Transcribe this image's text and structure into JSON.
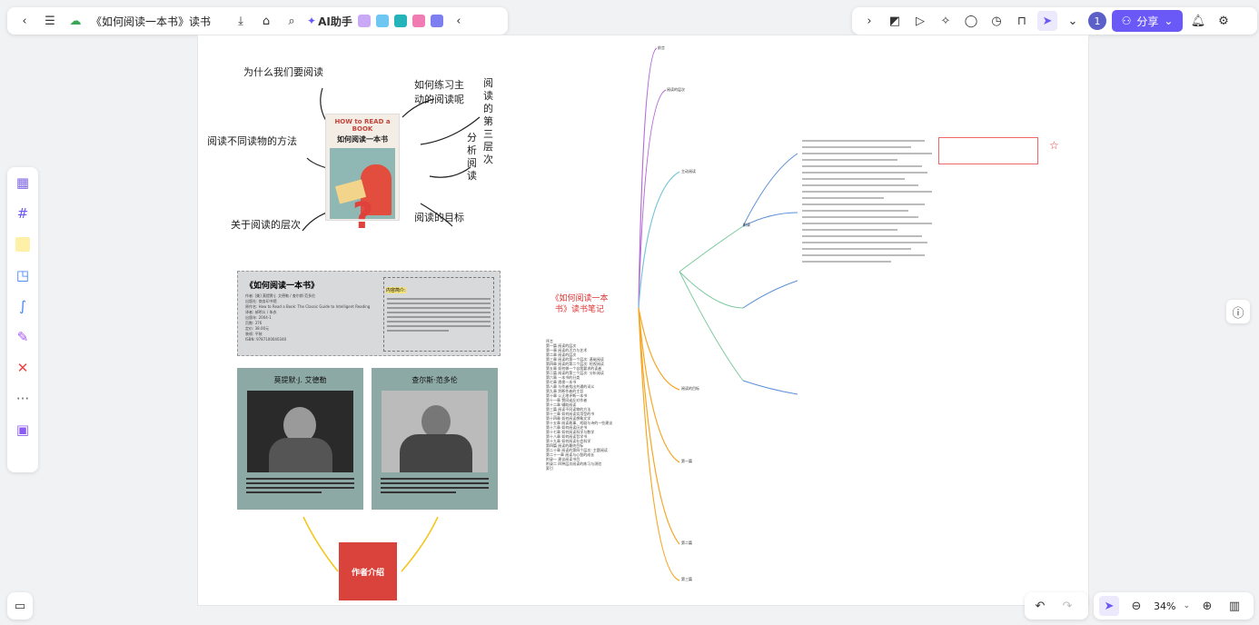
{
  "toolbar": {
    "doc_title": "《如何阅读一本书》读书...",
    "ai_label": "AI助手",
    "share_label": "分享",
    "avatar_label": "1"
  },
  "icons": [
    "back-icon",
    "menu-icon",
    "cloud-icon",
    "download-icon",
    "tag-icon",
    "search-icon"
  ],
  "book_cover": {
    "title_en": "HOW to READ a BOOK",
    "title_cn": "如何阅读一本书"
  },
  "sketch_labels": [
    "为什么我们要阅读",
    "如何练习主动的阅读呢",
    "阅读的第三层次",
    "阅读不同读物的方法",
    "分析阅读",
    "关于阅读的层次",
    "阅读的目标"
  ],
  "info_card": {
    "title": "《如何阅读一本书》",
    "lines": [
      "作者: [美] 莫提默·J. 艾德勒 / 查尔斯·范多伦",
      "出版社: 商务印书馆",
      "原作名: How to Read a Book: The Classic Guide to Intelligent Reading",
      "译者: 郝明义 / 朱衣",
      "出版年: 2004-1",
      "页数: 376",
      "定价: 38.00元",
      "装帧: 平装",
      "ISBN: 9787100040340"
    ],
    "intro_heading": "内容简介:"
  },
  "authors": [
    {
      "name": "莫提默·J. 艾德勒"
    },
    {
      "name": "查尔斯·范多伦"
    }
  ],
  "author_label": "作者介绍",
  "mindmap": {
    "center": "《如何阅读一本书》读书笔记",
    "branches": [
      "前言",
      "阅读的层次",
      "主动阅读",
      "阅读的目标",
      "第一篇",
      "第二篇",
      "第三篇",
      "附录"
    ]
  },
  "toc": [
    "序言",
    "第一篇 阅读的层次",
    "第一章 阅读的活力与艺术",
    "第二章 阅读的层次",
    "第三章 阅读的第一个层次: 基础阅读",
    "第四章 阅读的第二个层次: 检视阅读",
    "第五章 如何做一个自我要求的读者",
    "第二篇 阅读的第三个层次: 分析阅读",
    "第六章 一本书的分类",
    "第七章 透视一本书",
    "第八章 与作者找出共通的词义",
    "第九章 判断作者的主旨",
    "第十章 公正地评断一本书",
    "第十一章 赞同或反对作者",
    "第十二章 辅助阅读",
    "第三篇 阅读不同读物的方法",
    "第十三章 如何阅读实用型的书",
    "第十四章 如何阅读想象文学",
    "第十五章 阅读故事、戏剧与诗的一些建议",
    "第十六章 如何阅读历史书",
    "第十七章 如何阅读科学与数学",
    "第十八章 如何阅读哲学书",
    "第十九章 如何阅读社会科学",
    "第四篇 阅读的最终目标",
    "第二十章 阅读的第四个层次: 主题阅读",
    "第二十一章 阅读与心智的成长",
    "附录一 建议阅读书目",
    "附录二 四种层次阅读的练习与测验",
    "索引"
  ],
  "zoom": "34%",
  "colors": {
    "accent": "#6b59f7",
    "card_bg": "#d8d9da",
    "author_bg": "#8ca9a5",
    "red": "#d9433b",
    "center_red": "#d33"
  }
}
